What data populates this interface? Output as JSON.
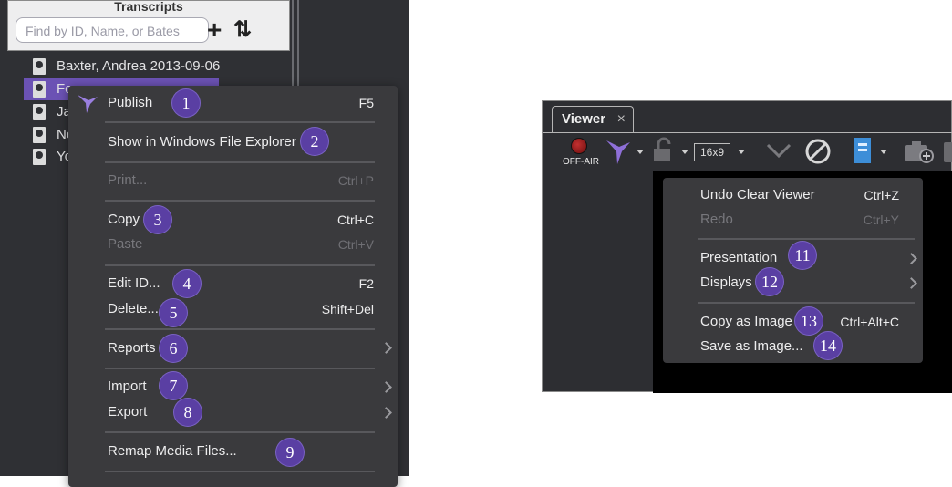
{
  "transcripts": {
    "title": "Transcripts",
    "search_placeholder": "Find by ID, Name, or Bates",
    "add_icon": "plus-icon",
    "sort_icon": "sort-arrows-icon",
    "rows": [
      {
        "label": "Baxter, Andrea 2013-09-06"
      },
      {
        "label": "Fo"
      },
      {
        "label": "Ja"
      },
      {
        "label": "Ne"
      },
      {
        "label": "Yo"
      }
    ]
  },
  "context_menu": {
    "items": {
      "publish": {
        "label": "Publish",
        "shortcut": "F5",
        "badge": "1"
      },
      "show_explorer": {
        "label": "Show in Windows File Explorer",
        "badge": "2"
      },
      "print": {
        "label": "Print...",
        "shortcut": "Ctrl+P"
      },
      "copy": {
        "label": "Copy",
        "shortcut": "Ctrl+C",
        "badge": "3"
      },
      "paste": {
        "label": "Paste",
        "shortcut": "Ctrl+V"
      },
      "edit_id": {
        "label": "Edit ID...",
        "shortcut": "F2",
        "badge": "4"
      },
      "delete": {
        "label": "Delete...",
        "shortcut": "Shift+Del",
        "badge": "5"
      },
      "reports": {
        "label": "Reports",
        "badge": "6"
      },
      "import": {
        "label": "Import",
        "badge": "7"
      },
      "export": {
        "label": "Export",
        "badge": "8"
      },
      "remap": {
        "label": "Remap Media Files...",
        "badge": "9"
      }
    }
  },
  "viewer": {
    "tab_label": "Viewer",
    "tab_close": "×",
    "offair_label": "OFF-AIR",
    "aspect_label": "16x9",
    "menu": {
      "undo": {
        "label": "Undo Clear Viewer",
        "shortcut": "Ctrl+Z"
      },
      "redo": {
        "label": "Redo",
        "shortcut": "Ctrl+Y"
      },
      "presentation": {
        "label": "Presentation",
        "badge": "11"
      },
      "displays": {
        "label": "Displays",
        "badge": "12"
      },
      "copy_image": {
        "label": "Copy as Image",
        "shortcut": "Ctrl+Alt+C",
        "badge": "13"
      },
      "save_image": {
        "label": "Save as Image...",
        "badge": "14"
      }
    }
  },
  "colors": {
    "accent": "#6b52b4",
    "badge": "#5a3fa3",
    "menu_bg": "#3a3a3d",
    "panel_bg": "#2f3034"
  }
}
